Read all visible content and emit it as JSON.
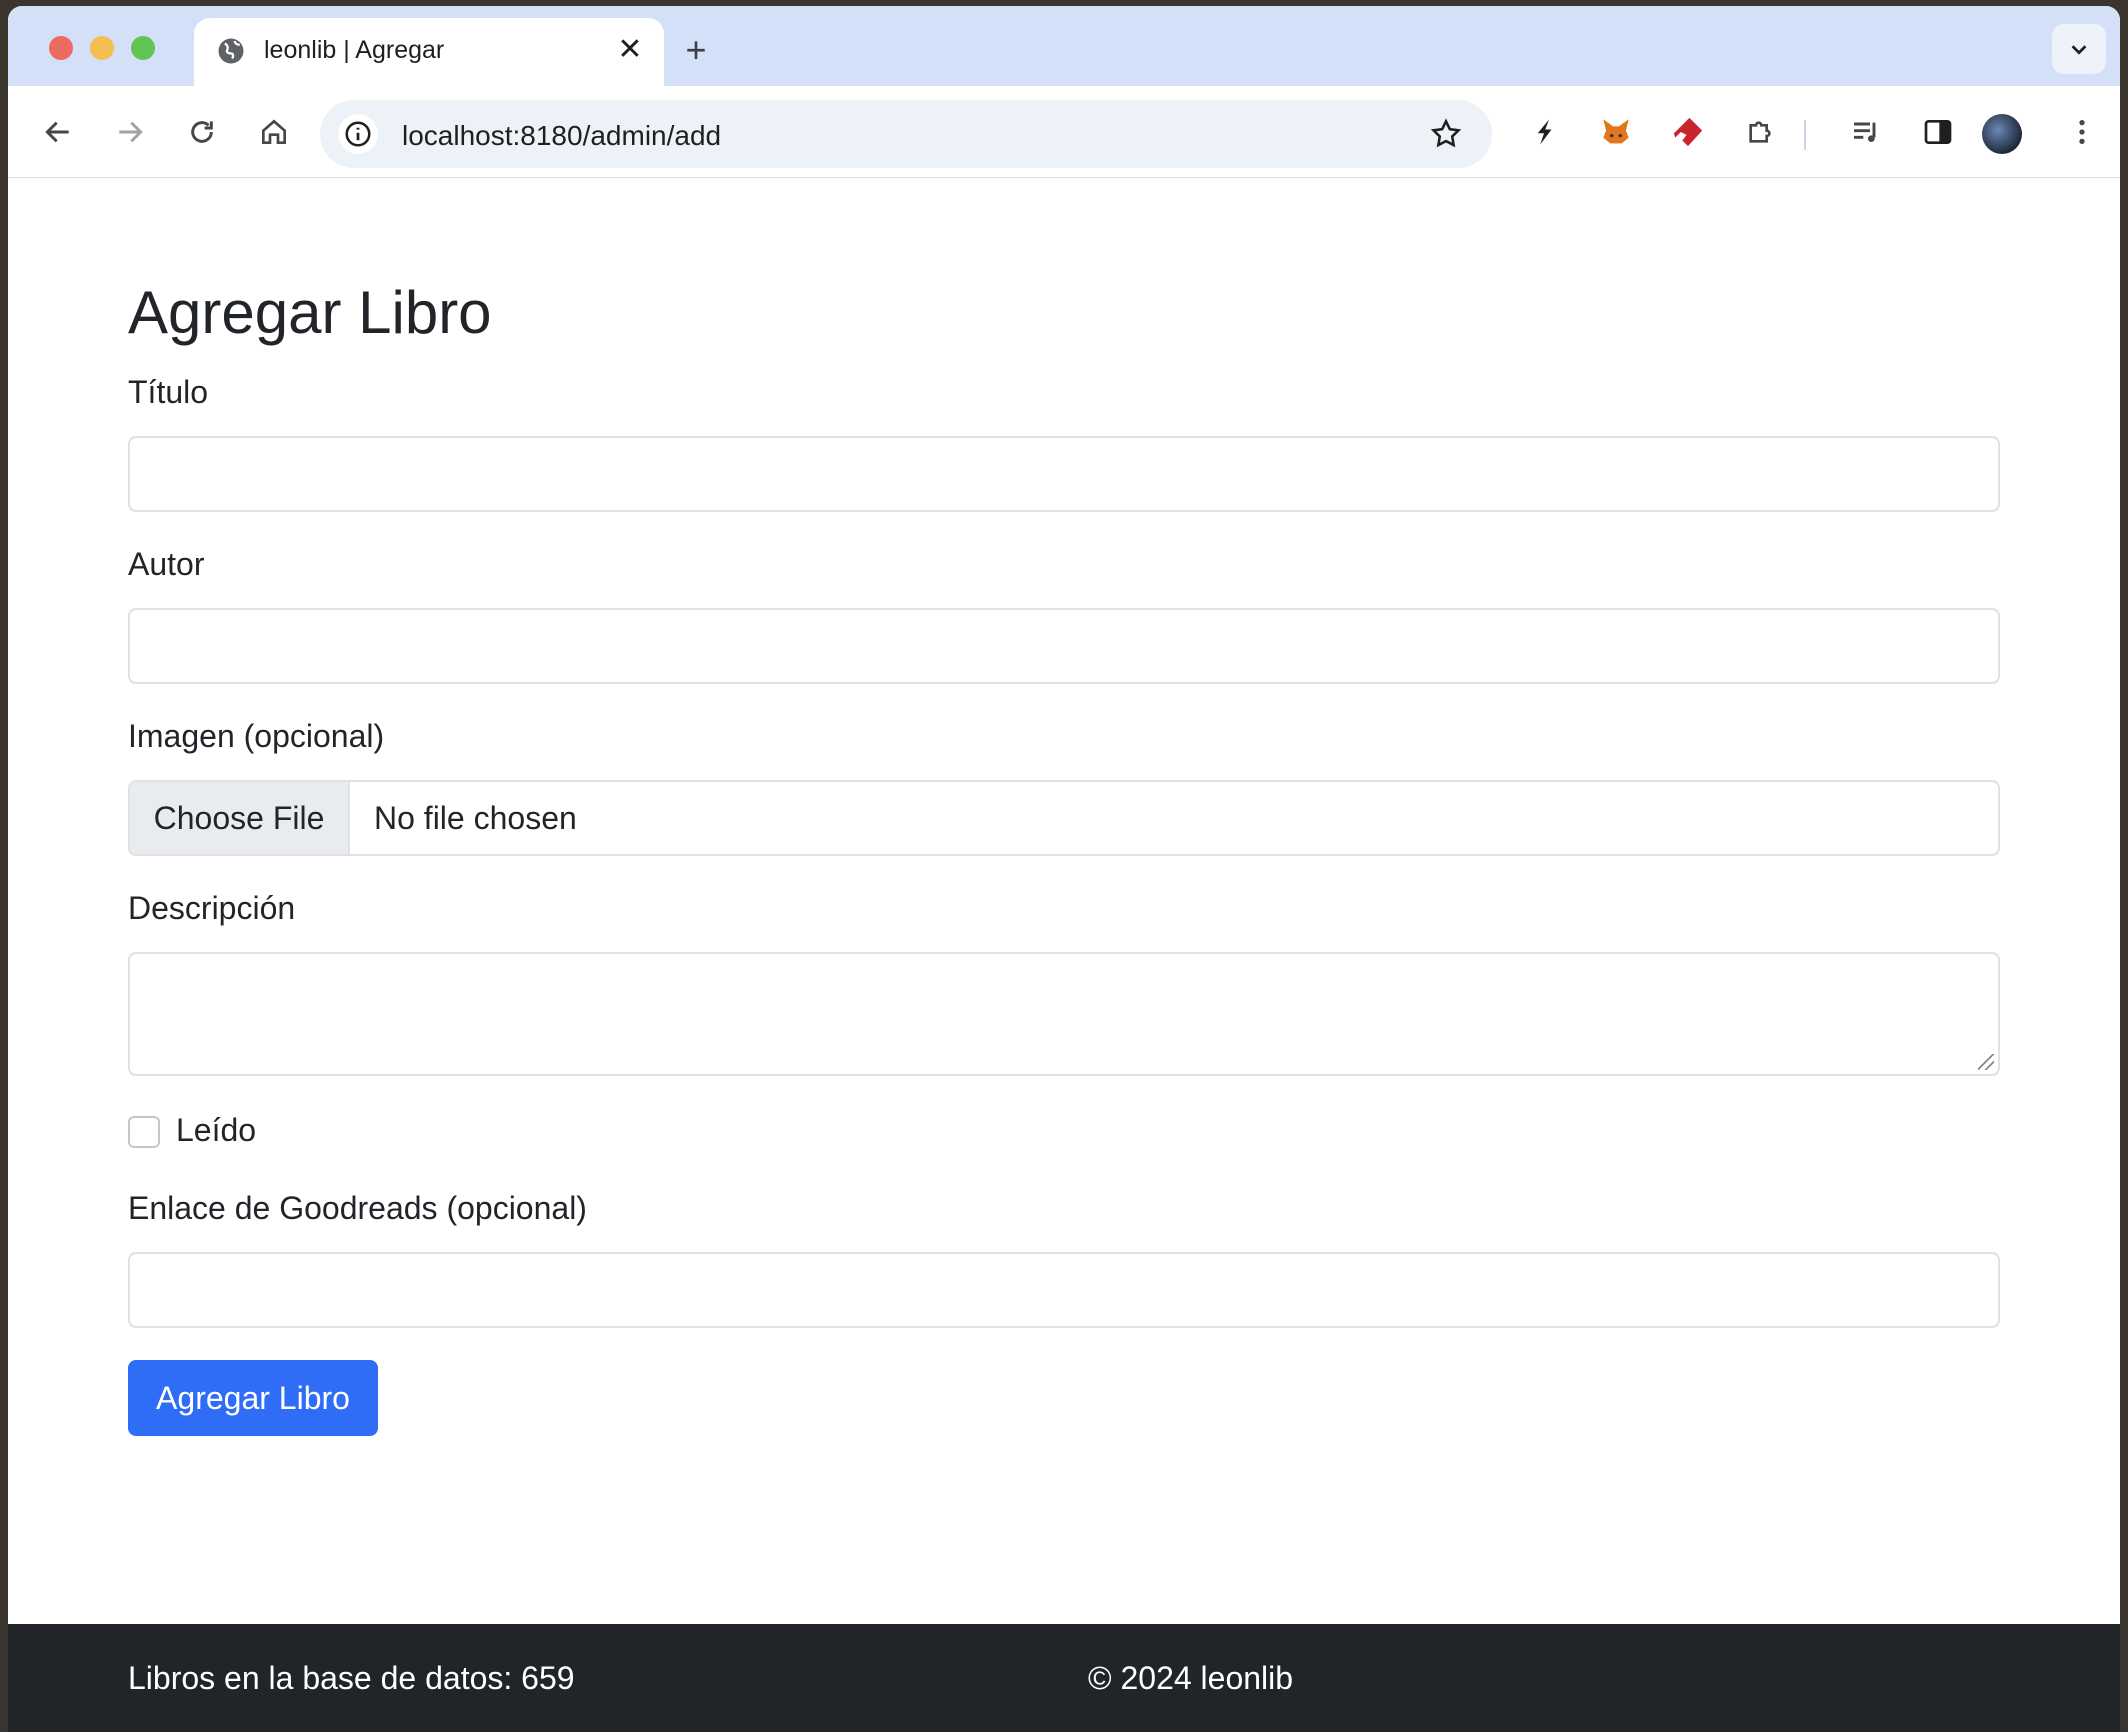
{
  "browser": {
    "tab_title": "leonlib | Agregar",
    "url": "localhost:8180/admin/add",
    "new_tab_label": "+",
    "close_label": "✕"
  },
  "form": {
    "heading": "Agregar Libro",
    "title_label": "Título",
    "title_value": "",
    "author_label": "Autor",
    "author_value": "",
    "image_label": "Imagen (opcional)",
    "choose_file_label": "Choose File",
    "file_status": "No file chosen",
    "description_label": "Descripción",
    "read_label": "Leído",
    "read_checked": false,
    "goodreads_label": "Enlace de Goodreads (opcional)",
    "goodreads_value": "",
    "submit_label": "Agregar Libro"
  },
  "footer": {
    "book_count_text": "Libros en la base de datos: 659",
    "copyright": "© 2024 leonlib"
  },
  "colors": {
    "primary": "#2f6df6",
    "footer_bg": "#212529",
    "tabstrip_bg": "#d3e0f7"
  }
}
